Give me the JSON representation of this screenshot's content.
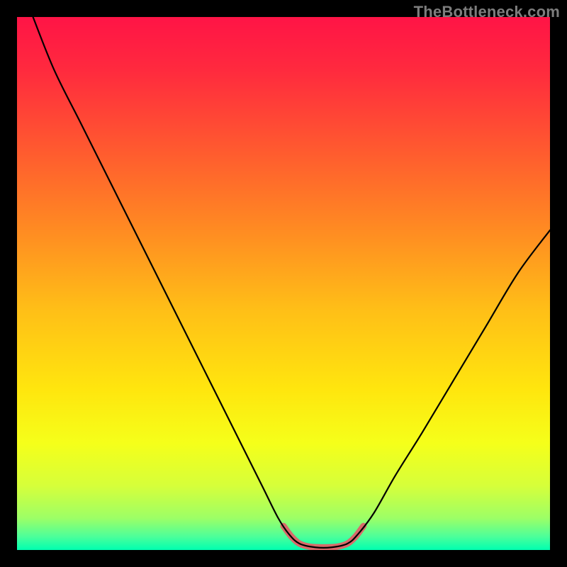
{
  "watermark": "TheBottleneck.com",
  "chart_data": {
    "type": "line",
    "title": "",
    "xlabel": "",
    "ylabel": "",
    "xlim": [
      0,
      100
    ],
    "ylim": [
      0,
      100
    ],
    "gradient_stops": [
      {
        "offset": 0.0,
        "color": "#ff1446"
      },
      {
        "offset": 0.1,
        "color": "#ff2a3e"
      },
      {
        "offset": 0.25,
        "color": "#ff5a2f"
      },
      {
        "offset": 0.4,
        "color": "#ff8b22"
      },
      {
        "offset": 0.55,
        "color": "#ffbf17"
      },
      {
        "offset": 0.7,
        "color": "#ffe60e"
      },
      {
        "offset": 0.8,
        "color": "#f5ff1a"
      },
      {
        "offset": 0.88,
        "color": "#d6ff3a"
      },
      {
        "offset": 0.94,
        "color": "#9dff66"
      },
      {
        "offset": 0.975,
        "color": "#4cff9a"
      },
      {
        "offset": 1.0,
        "color": "#00ffb0"
      }
    ],
    "series": [
      {
        "name": "bottleneck-curve",
        "stroke": "#000000",
        "stroke_width": 2.2,
        "points": [
          {
            "x": 3.0,
            "y": 100.0
          },
          {
            "x": 7.0,
            "y": 90.0
          },
          {
            "x": 12.0,
            "y": 80.0
          },
          {
            "x": 18.0,
            "y": 68.0
          },
          {
            "x": 24.0,
            "y": 56.0
          },
          {
            "x": 30.0,
            "y": 44.0
          },
          {
            "x": 36.0,
            "y": 32.0
          },
          {
            "x": 42.0,
            "y": 20.0
          },
          {
            "x": 46.0,
            "y": 12.0
          },
          {
            "x": 49.0,
            "y": 6.0
          },
          {
            "x": 51.0,
            "y": 3.0
          },
          {
            "x": 53.0,
            "y": 1.2
          },
          {
            "x": 56.0,
            "y": 0.5
          },
          {
            "x": 59.0,
            "y": 0.5
          },
          {
            "x": 62.0,
            "y": 1.2
          },
          {
            "x": 64.0,
            "y": 3.0
          },
          {
            "x": 67.0,
            "y": 7.0
          },
          {
            "x": 71.0,
            "y": 14.0
          },
          {
            "x": 76.0,
            "y": 22.0
          },
          {
            "x": 82.0,
            "y": 32.0
          },
          {
            "x": 88.0,
            "y": 42.0
          },
          {
            "x": 94.0,
            "y": 52.0
          },
          {
            "x": 100.0,
            "y": 60.0
          }
        ]
      },
      {
        "name": "optimal-zone-highlight",
        "stroke": "#d96a6a",
        "stroke_width": 9,
        "points": [
          {
            "x": 50.0,
            "y": 4.5
          },
          {
            "x": 51.5,
            "y": 2.5
          },
          {
            "x": 53.0,
            "y": 1.2
          },
          {
            "x": 55.0,
            "y": 0.6
          },
          {
            "x": 57.5,
            "y": 0.5
          },
          {
            "x": 60.0,
            "y": 0.6
          },
          {
            "x": 62.0,
            "y": 1.2
          },
          {
            "x": 63.5,
            "y": 2.5
          },
          {
            "x": 65.0,
            "y": 4.5
          }
        ]
      }
    ]
  }
}
